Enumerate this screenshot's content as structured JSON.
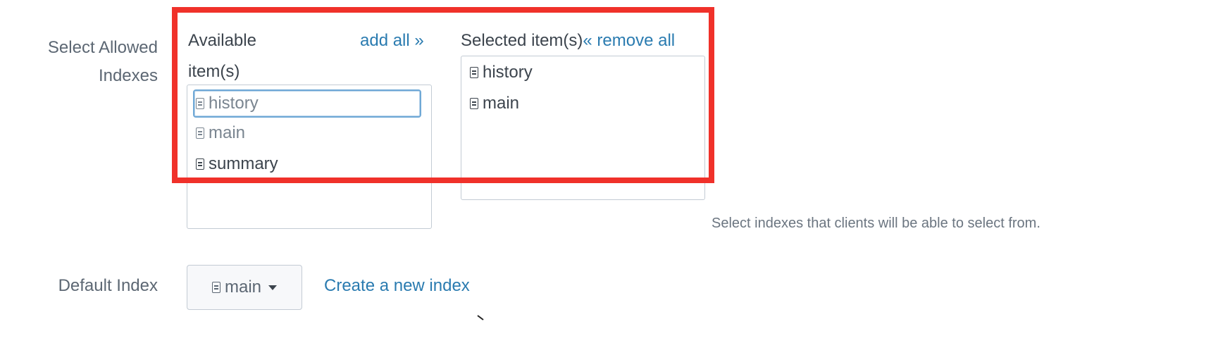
{
  "allowed_indexes": {
    "label_line1": "Select Allowed",
    "label_line2": "Indexes",
    "available_header_line1": "Available",
    "available_header_line2": "item(s)",
    "add_all_label": "add all »",
    "selected_header": "Selected item(s)",
    "remove_all_label": "« remove all",
    "available_items": [
      {
        "label": "history",
        "icon": "index-icon"
      },
      {
        "label": "main",
        "icon": "index-icon"
      },
      {
        "label": "summary",
        "icon": "index-icon"
      }
    ],
    "selected_items": [
      {
        "label": "history",
        "icon": "index-icon"
      },
      {
        "label": "main",
        "icon": "index-icon"
      }
    ],
    "help_text": "Select indexes that clients will be able to select from."
  },
  "default_index": {
    "label": "Default Index",
    "selected_value": "main",
    "create_link_label": "Create a new index"
  },
  "colors": {
    "link": "#2a7bb0",
    "highlight": "#f0312a",
    "border": "#c3cbd4"
  }
}
